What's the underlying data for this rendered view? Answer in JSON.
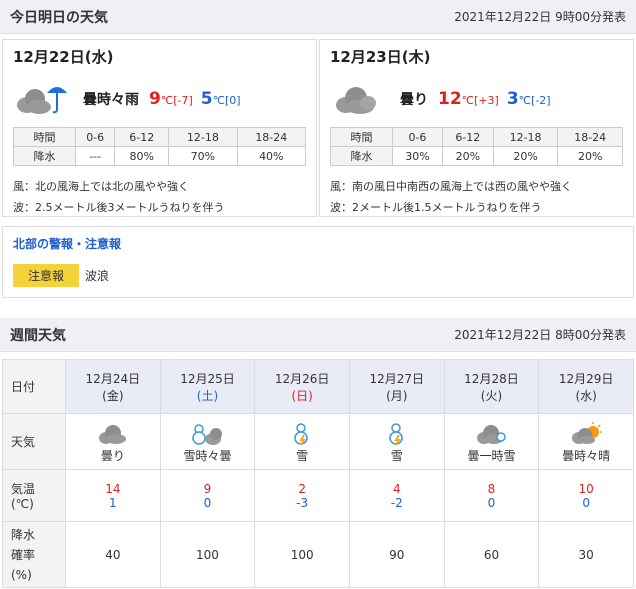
{
  "today_section": {
    "title": "今日明日の天気",
    "issued": "2021年12月22日 9時00分発表"
  },
  "days": [
    {
      "date": "12月22日(水)",
      "icon": "cloud-rain-icon",
      "weather": "曇時々雨",
      "hi": "9",
      "hi_diff": "℃[-7]",
      "lo": "5",
      "lo_diff": "℃[0]",
      "periods": [
        "0-6",
        "6-12",
        "12-18",
        "18-24"
      ],
      "rain": [
        "---",
        "80%",
        "70%",
        "40%"
      ],
      "wind": "風：北の風海上では北の風やや強く",
      "wave": "波：2.5メートル後3メートルうねりを伴う"
    },
    {
      "date": "12月23日(木)",
      "icon": "cloud-icon",
      "weather": "曇り",
      "hi": "12",
      "hi_diff": "℃[+3]",
      "lo": "3",
      "lo_diff": "℃[-2]",
      "periods": [
        "0-6",
        "6-12",
        "12-18",
        "18-24"
      ],
      "rain": [
        "30%",
        "20%",
        "20%",
        "20%"
      ],
      "wind": "風：南の風日中南西の風海上では西の風やや強く",
      "wave": "波：2メートル後1.5メートルうねりを伴う"
    }
  ],
  "table_labels": {
    "time": "時間",
    "rain": "降水"
  },
  "warnings": {
    "title": "北部の警報・注意報",
    "badge": "注意報",
    "item": "波浪"
  },
  "weekly_section": {
    "title": "週間天気",
    "issued": "2021年12月22日 8時00分発表"
  },
  "weekly_labels": {
    "date": "日付",
    "weather": "天気",
    "temp1": "気温",
    "temp2": "(℃)",
    "rain1": "降水",
    "rain2": "確率",
    "rain3": "(%)"
  },
  "weekly": [
    {
      "date": "12月24日",
      "dow": "(金)",
      "icon": "cloud-icon",
      "weather": "曇り",
      "hi": "14",
      "lo": "1",
      "pop": "40"
    },
    {
      "date": "12月25日",
      "dow": "(土)",
      "icon": "snowman-cloud-icon",
      "weather": "雪時々曇",
      "hi": "9",
      "lo": "0",
      "pop": "100"
    },
    {
      "date": "12月26日",
      "dow": "(日)",
      "icon": "snow-thunder-icon",
      "weather": "雪",
      "hi": "2",
      "lo": "-3",
      "pop": "100"
    },
    {
      "date": "12月27日",
      "dow": "(月)",
      "icon": "snow-thunder-icon",
      "weather": "雪",
      "hi": "4",
      "lo": "-2",
      "pop": "90"
    },
    {
      "date": "12月28日",
      "dow": "(火)",
      "icon": "cloud-snow-icon",
      "weather": "曇一時雪",
      "hi": "8",
      "lo": "0",
      "pop": "60"
    },
    {
      "date": "12月29日",
      "dow": "(水)",
      "icon": "cloud-sun-icon",
      "weather": "曇時々晴",
      "hi": "10",
      "lo": "0",
      "pop": "30"
    }
  ]
}
